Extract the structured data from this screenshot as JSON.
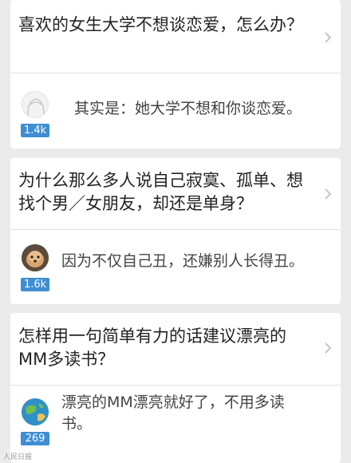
{
  "feed": {
    "items": [
      {
        "question": "喜欢的女生大学不想谈恋爱，怎么办？",
        "answer": "其实是：她大学不想和你谈恋爱。",
        "votes": "1.4k"
      },
      {
        "question": "为什么那么多人说自己寂寞、孤单、想找个男／女朋友，却还是单身？",
        "answer": "因为不仅自己丑，还嫌别人长得丑。",
        "votes": "1.6k"
      },
      {
        "question": "怎样用一句简单有力的话建议漂亮的MM多读书？",
        "answer": "漂亮的MM漂亮就好了，不用多读书。",
        "votes": "269"
      }
    ]
  },
  "watermark": "人民日报",
  "colors": {
    "badge": "#3e8ed3",
    "background": "#ebebeb",
    "card": "#ffffff"
  },
  "icons": [
    "chevron-right-icon",
    "avatar-placeholder-icon",
    "avatar-dog-photo",
    "avatar-earth-image"
  ]
}
